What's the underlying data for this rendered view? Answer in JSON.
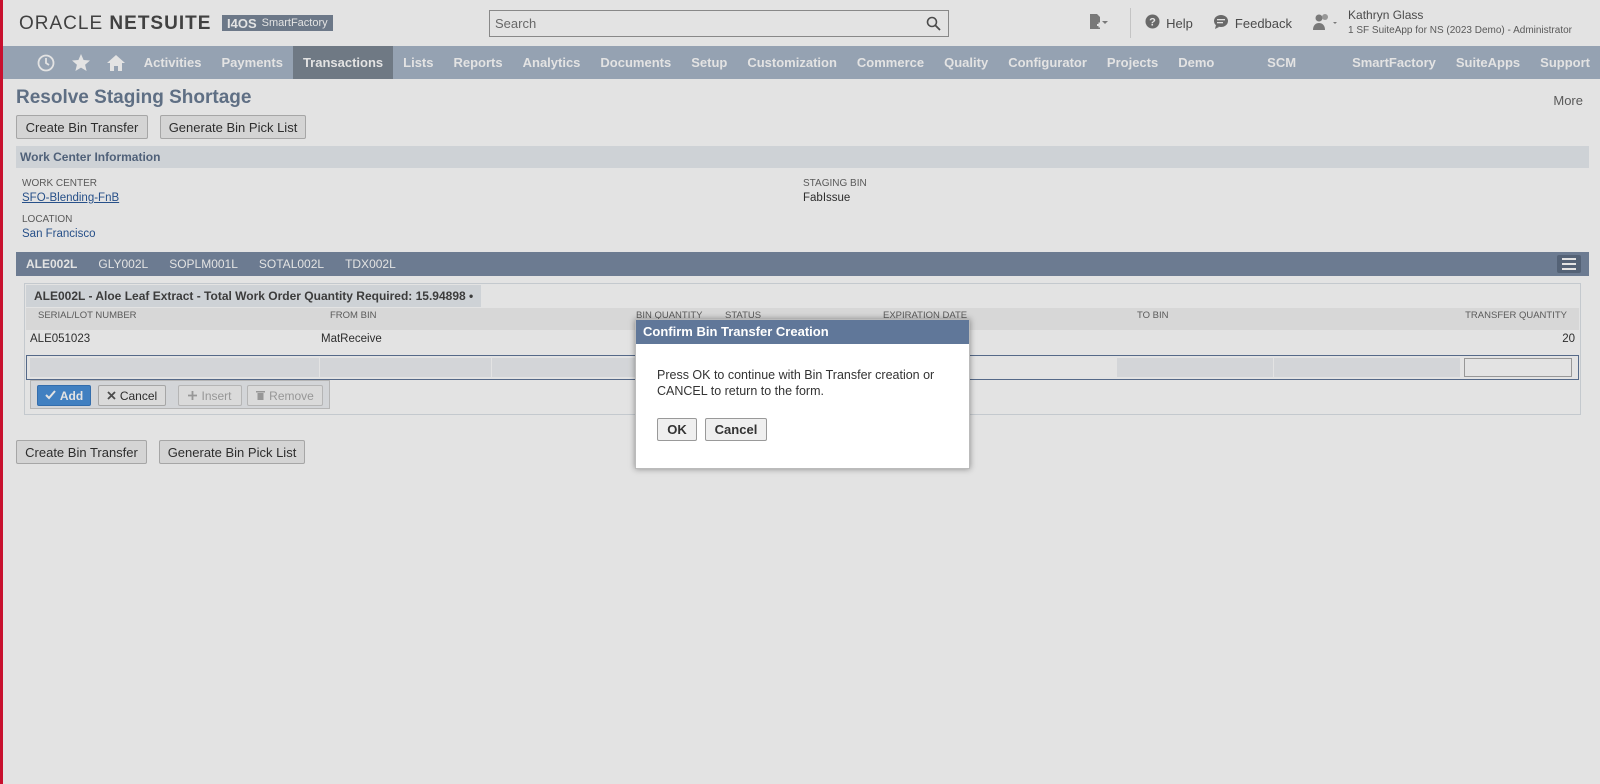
{
  "header": {
    "logo_text": "ORACLE NETSUITE",
    "logo_brand": "ORACLE",
    "logo_product": "NETSUITE",
    "secondary_logo_i4": "I4OS",
    "secondary_logo_name": "SmartFactory",
    "search_placeholder": "Search",
    "help_label": "Help",
    "feedback_label": "Feedback",
    "user_name": "Kathryn Glass",
    "user_role": "1 SF SuiteApp for NS (2023 Demo) - Administrator"
  },
  "nav": {
    "icons": [
      "recent-icon",
      "star-icon",
      "home-icon"
    ],
    "items": [
      {
        "label": "Activities",
        "active": false
      },
      {
        "label": "Payments",
        "active": false
      },
      {
        "label": "Transactions",
        "active": true
      },
      {
        "label": "Lists",
        "active": false
      },
      {
        "label": "Reports",
        "active": false
      },
      {
        "label": "Analytics",
        "active": false
      },
      {
        "label": "Documents",
        "active": false
      },
      {
        "label": "Setup",
        "active": false
      },
      {
        "label": "Customization",
        "active": false
      },
      {
        "label": "Commerce",
        "active": false
      },
      {
        "label": "Quality",
        "active": false
      },
      {
        "label": "Configurator",
        "active": false
      },
      {
        "label": "Projects",
        "active": false
      },
      {
        "label": "Demo Assist",
        "active": false
      },
      {
        "label": "SCM Mobile",
        "active": false
      },
      {
        "label": "SmartFactory",
        "active": false
      },
      {
        "label": "SuiteApps",
        "active": false
      },
      {
        "label": "Support",
        "active": false
      }
    ]
  },
  "page": {
    "title": "Resolve Staging Shortage",
    "more_label": "More",
    "create_bin_transfer": "Create Bin Transfer",
    "generate_bin_pick_list": "Generate Bin Pick List"
  },
  "work_center": {
    "section_title": "Work Center Information",
    "work_center_label": "WORK CENTER",
    "work_center_value": "SFO-Blending-FnB",
    "location_label": "LOCATION",
    "location_value": "San Francisco",
    "staging_bin_label": "STAGING BIN",
    "staging_bin_value": "FabIssue"
  },
  "subtabs": [
    {
      "label": "ALE002L",
      "active": true
    },
    {
      "label": "GLY002L",
      "active": false
    },
    {
      "label": "SOPLM001L",
      "active": false
    },
    {
      "label": "SOTAL002L",
      "active": false
    },
    {
      "label": "TDX002L",
      "active": false
    }
  ],
  "sublist": {
    "title": "ALE002L - Aloe Leaf Extract - Total Work Order Quantity Required: 15.94898 •",
    "columns": [
      "SERIAL/LOT NUMBER",
      "FROM BIN",
      "BIN QUANTITY",
      "STATUS",
      "EXPIRATION DATE",
      "TO BIN",
      "TRANSFER QUANTITY"
    ],
    "row": {
      "serial": "ALE051023",
      "from_bin": "MatReceive",
      "transfer_quantity": "20"
    },
    "actions": {
      "add": "Add",
      "cancel": "Cancel",
      "insert": "Insert",
      "remove": "Remove"
    }
  },
  "dialog": {
    "title": "Confirm Bin Transfer Creation",
    "message": "Press OK to continue with Bin Transfer creation or CANCEL to return to the form.",
    "ok_label": "OK",
    "cancel_label": "Cancel"
  },
  "colors": {
    "nav_bg": "#a8b6c8",
    "nav_active": "#7d8895",
    "title_color": "#6b7d95",
    "dialog_header": "#607799",
    "accent_red": "#c8102e",
    "add_button": "#4a90d9"
  }
}
